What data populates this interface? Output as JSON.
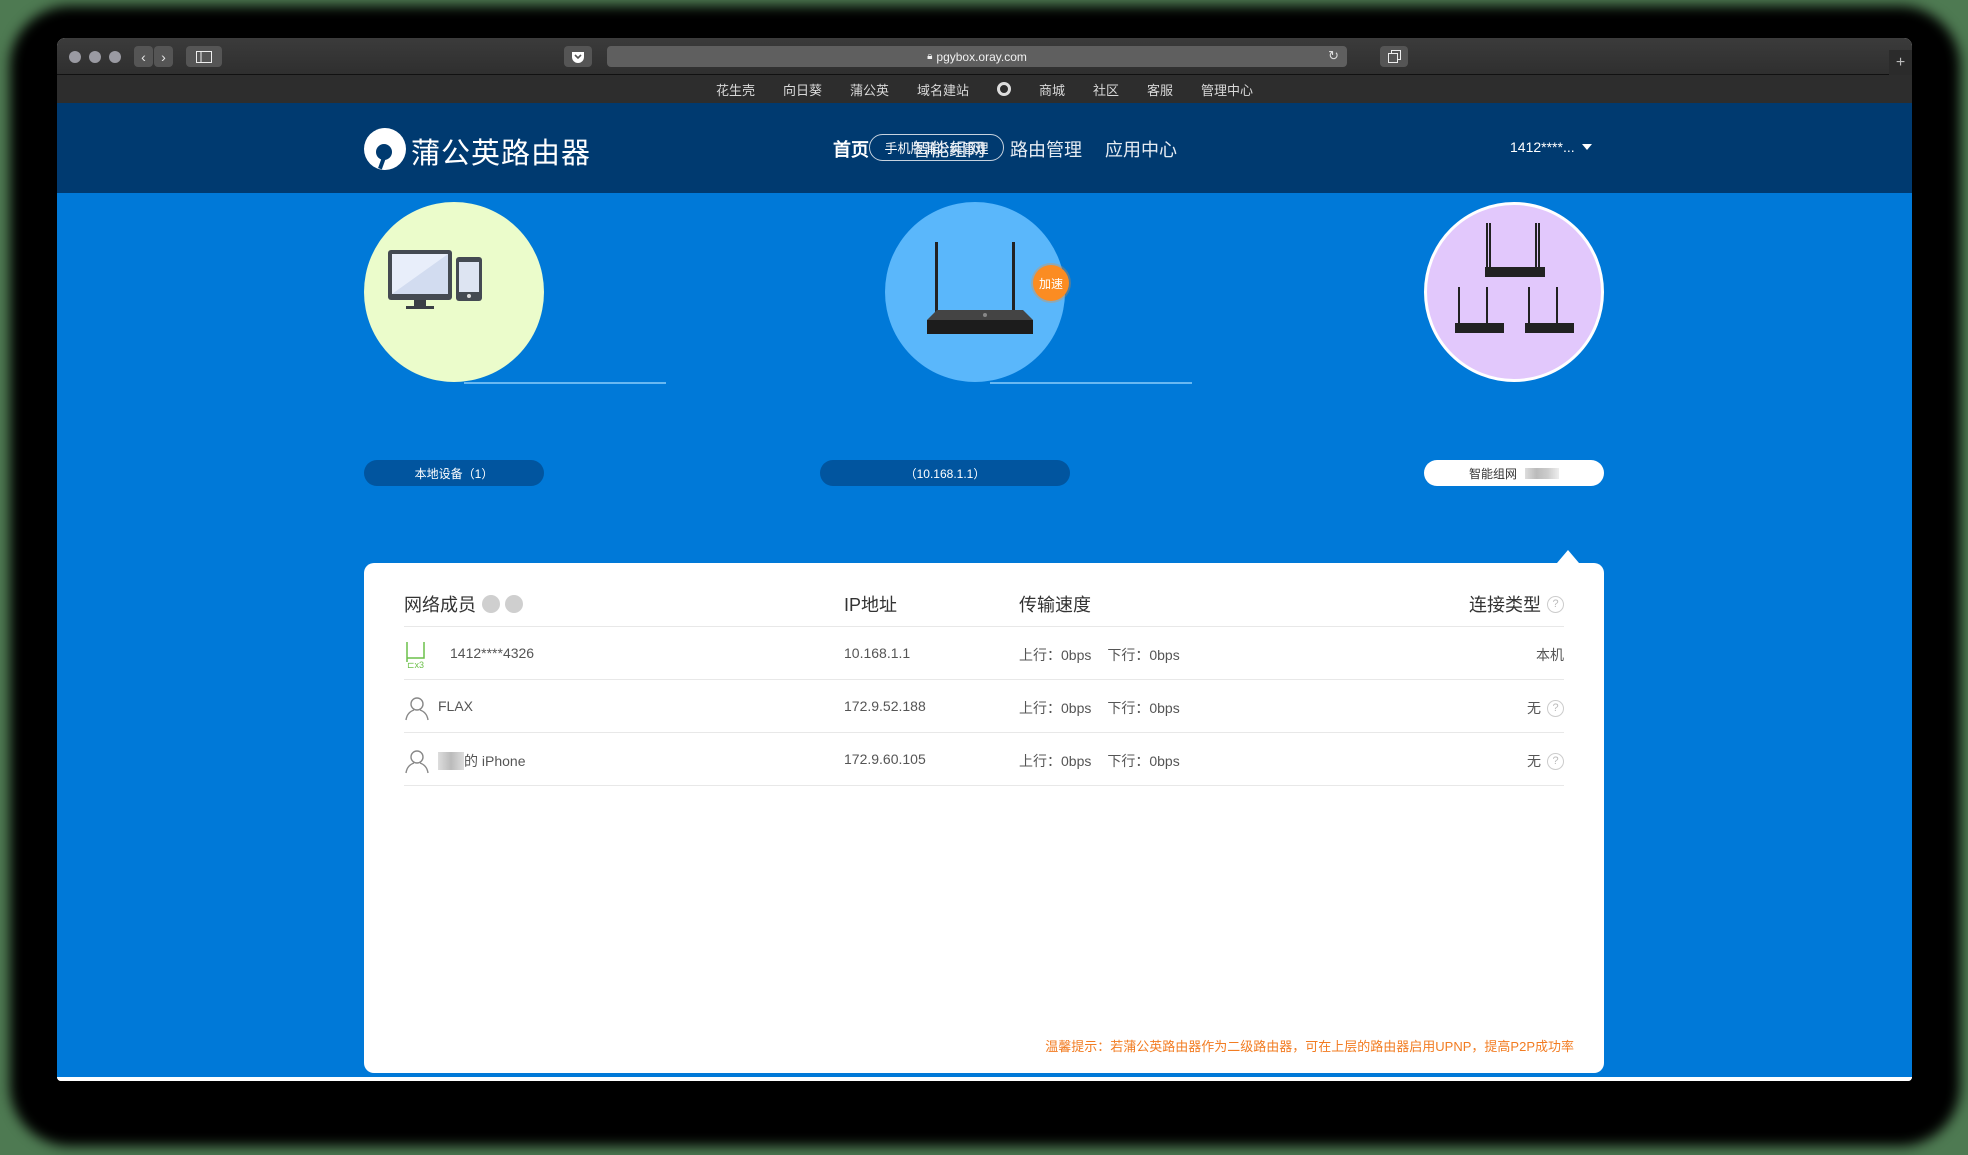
{
  "browser": {
    "url": "pgybox.oray.com",
    "bookmarks": [
      "花生壳",
      "向日葵",
      "蒲公英",
      "域名建站",
      "商城",
      "社区",
      "客服",
      "管理中心"
    ],
    "new_tab_label": "+"
  },
  "header": {
    "brand": "蒲公英路由器",
    "mobile_button": "手机版蒲公英管理",
    "nav": [
      "首页",
      "智能组网",
      "路由管理",
      "应用中心"
    ],
    "active_nav": "首页",
    "user": "1412****..."
  },
  "topology": {
    "local_label": "本地设备（1）",
    "router_label": "（10.168.1.1）",
    "router_badge": "加速",
    "mesh_label": "智能组网"
  },
  "members": {
    "headers": {
      "name": "网络成员",
      "ip": "IP地址",
      "speed": "传输速度",
      "type": "连接类型"
    },
    "rows": [
      {
        "icon": "router-x3-icon",
        "name": "1412****4326",
        "ip": "10.168.1.1",
        "up": "上行：0bps",
        "down": "下行：0bps",
        "type": "本机",
        "help": false
      },
      {
        "icon": "user-icon",
        "name": "FLAX",
        "ip": "172.9.52.188",
        "up": "上行：0bps",
        "down": "下行：0bps",
        "type": "无",
        "help": true
      },
      {
        "icon": "user-icon",
        "name": "的 iPhone",
        "ip": "172.9.60.105",
        "up": "上行：0bps",
        "down": "下行：0bps",
        "type": "无",
        "help": true
      }
    ],
    "tip": "温馨提示：若蒲公英路由器作为二级路由器，可在上层的路由器启用UPNP，提高P2P成功率"
  },
  "colors": {
    "header_bg": "#003a70",
    "main_bg": "#0079d8",
    "accent_orange": "#f27c22",
    "badge_orange": "#fb8c22",
    "router_green": "#6cc04a"
  }
}
